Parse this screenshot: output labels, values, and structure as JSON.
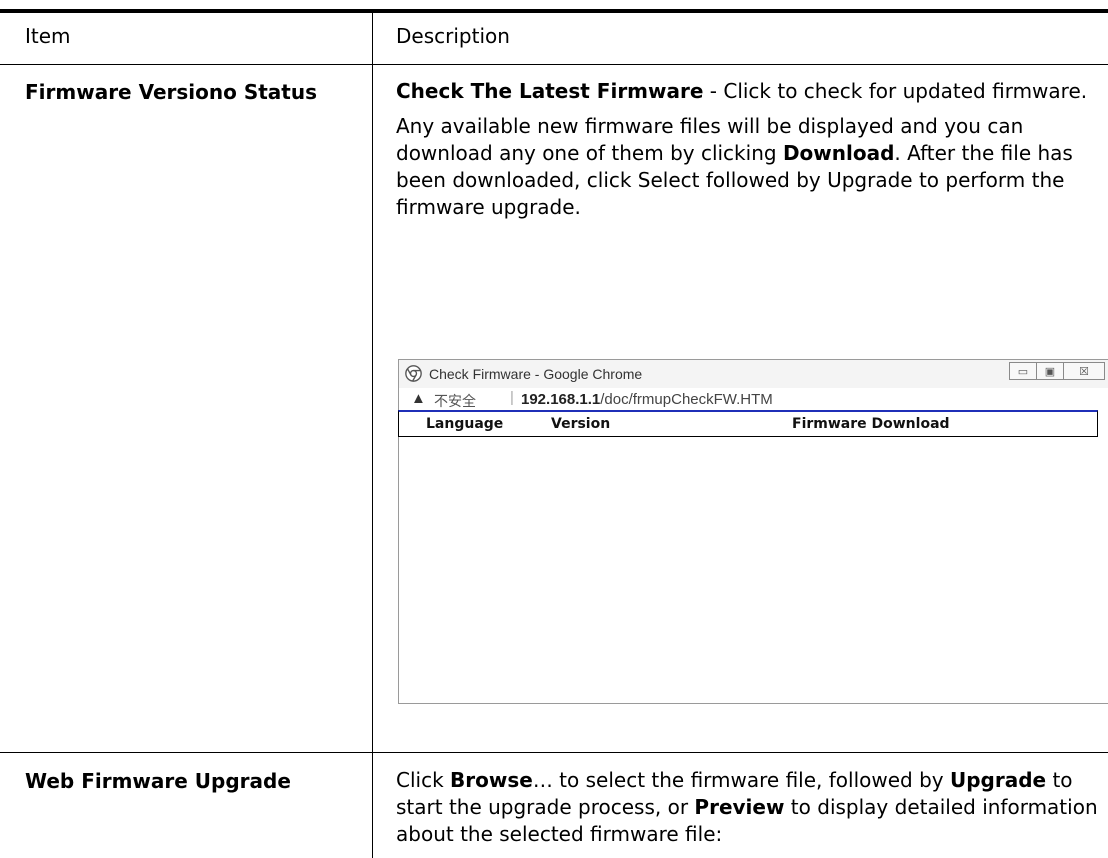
{
  "header": {
    "item": "Item",
    "description": "Description"
  },
  "rows": [
    {
      "item": "Firmware Versiono Status",
      "desc": {
        "p1_bold": "Check The Latest Firmware",
        "p1_rest": " - Click to check for updated firmware.",
        "p2_a": "Any available new firmware files will be displayed and you can download any one of them by clicking ",
        "p2_bold": "Download",
        "p2_b": ". After the file has been downloaded, click Select followed by Upgrade to perform the firmware upgrade."
      }
    },
    {
      "item": "Web Firmware Upgrade",
      "desc": {
        "a": "Click ",
        "browse": "Browse",
        "b": "… to select the firmware file, followed by ",
        "upgrade": "Upgrade",
        "c": " to start the upgrade process, or ",
        "preview": "Preview",
        "d": " to display detailed information about the selected firmware file:"
      }
    }
  ],
  "popup": {
    "title": "Check Firmware - Google Chrome",
    "warning_icon": "▲",
    "not_secure": "不安全",
    "separator": "|",
    "url_host": "192.168.1.1",
    "url_path": "/doc/frmupCheckFW.HTM",
    "table": {
      "columns": [
        "Language",
        "Version",
        "Firmware Download"
      ]
    },
    "buttons": {
      "minimize": "▭",
      "maximize": "▣",
      "close": "☒"
    }
  }
}
